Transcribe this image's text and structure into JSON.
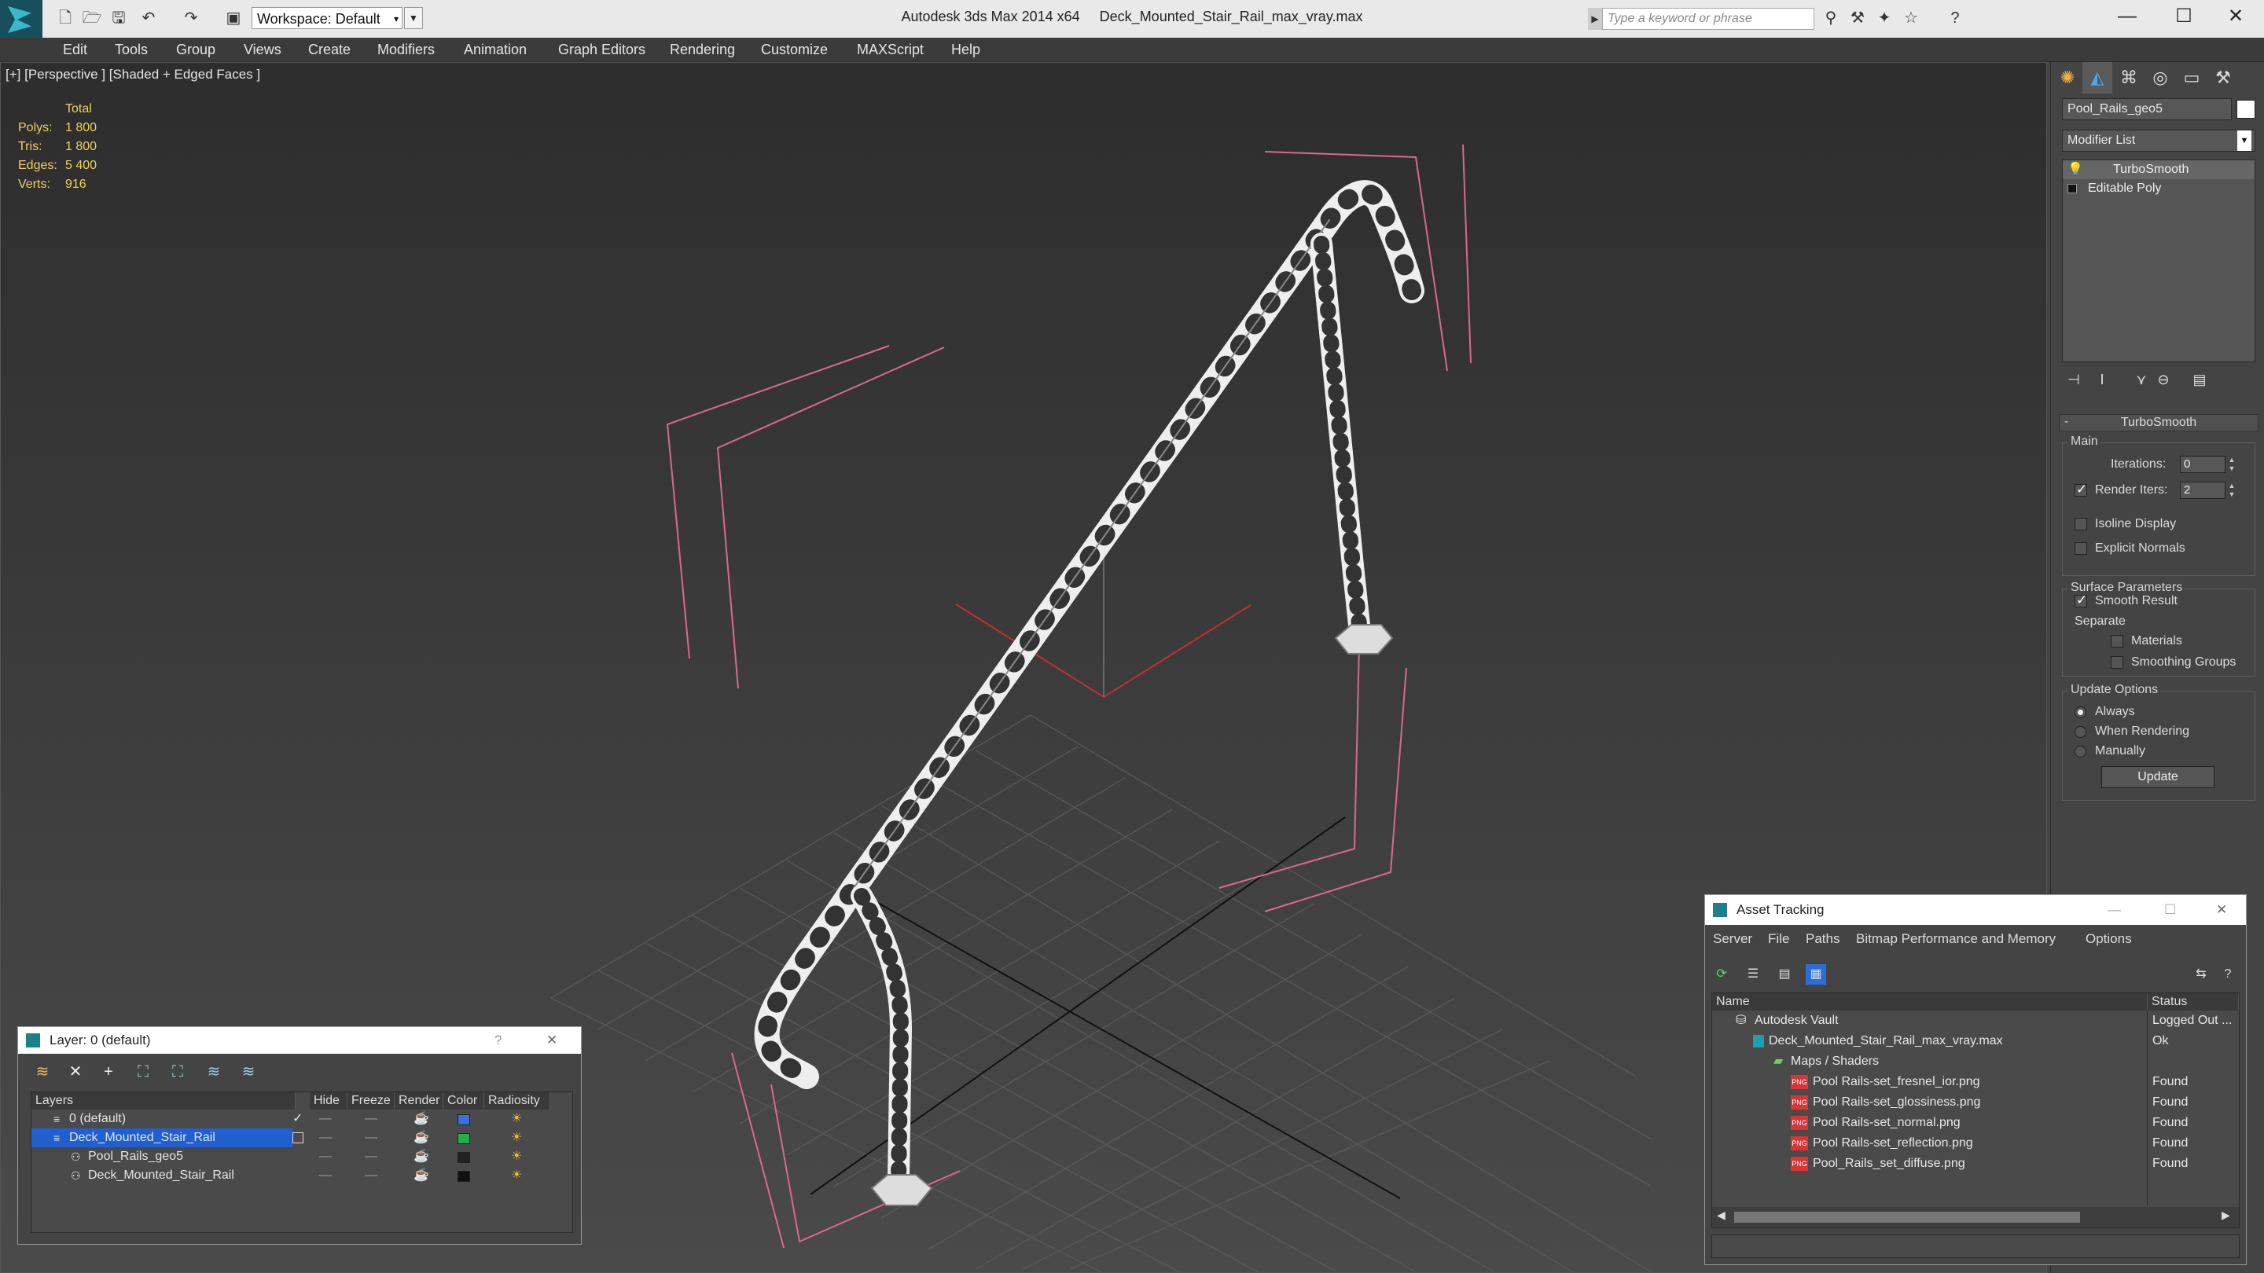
{
  "window": {
    "app_title": "Autodesk 3ds Max  2014 x64",
    "file_title": "Deck_Mounted_Stair_Rail_max_vray.max",
    "workspace": "Workspace: Default",
    "search_placeholder": "Type a keyword or phrase",
    "controls": {
      "minimize": "—",
      "maximize": "☐",
      "close": "✕"
    }
  },
  "menu": [
    "Edit",
    "Tools",
    "Group",
    "Views",
    "Create",
    "Modifiers",
    "Animation",
    "Graph Editors",
    "Rendering",
    "Customize",
    "MAXScript",
    "Help"
  ],
  "viewport": {
    "label": "[+] [Perspective ] [Shaded + Edged Faces ]",
    "stats": {
      "header": "Total",
      "rows": [
        {
          "label": "Polys:",
          "value": "1 800"
        },
        {
          "label": "Tris:",
          "value": "1 800"
        },
        {
          "label": "Edges:",
          "value": "5 400"
        },
        {
          "label": "Verts:",
          "value": "916"
        }
      ]
    }
  },
  "command_panel": {
    "object_name": "Pool_Rails_geo5",
    "modifier_list": "Modifier List",
    "stack": [
      "TurboSmooth",
      "Editable Poly"
    ],
    "rollout_title": "TurboSmooth",
    "main": {
      "title": "Main",
      "iterations_label": "Iterations:",
      "iterations_value": "0",
      "render_iters_label": "Render Iters:",
      "render_iters_value": "2",
      "isoline": "Isoline Display",
      "explicit_normals": "Explicit Normals"
    },
    "surface": {
      "title": "Surface Parameters",
      "smooth_result": "Smooth Result",
      "separate": "Separate",
      "materials": "Materials",
      "smoothing_groups": "Smoothing Groups"
    },
    "update": {
      "title": "Update Options",
      "always": "Always",
      "when_rendering": "When Rendering",
      "manually": "Manually",
      "button": "Update"
    }
  },
  "layer_panel": {
    "title": "Layer: 0 (default)",
    "help": "?",
    "close": "✕",
    "columns": [
      "Layers",
      "Hide",
      "Freeze",
      "Render",
      "Color",
      "Radiosity"
    ],
    "rows": [
      {
        "name": "0 (default)",
        "color": "#3b6fe0"
      },
      {
        "name": "Deck_Mounted_Stair_Rail",
        "color": "#22b04a"
      },
      {
        "name": "Pool_Rails_geo5",
        "color": "#222222"
      },
      {
        "name": "Deck_Mounted_Stair_Rail",
        "color": "#111111"
      }
    ]
  },
  "asset_panel": {
    "title": "Asset Tracking",
    "menu": [
      "Server",
      "File",
      "Paths",
      "Bitmap Performance and Memory",
      "Options"
    ],
    "columns": [
      "Name",
      "Status"
    ],
    "rows": [
      {
        "name": "Autodesk Vault",
        "status": "Logged Out ..."
      },
      {
        "name": "Deck_Mounted_Stair_Rail_max_vray.max",
        "status": "Ok"
      },
      {
        "name": "Maps / Shaders",
        "status": ""
      },
      {
        "name": "Pool Rails-set_fresnel_ior.png",
        "status": "Found"
      },
      {
        "name": "Pool Rails-set_glossiness.png",
        "status": "Found"
      },
      {
        "name": "Pool Rails-set_normal.png",
        "status": "Found"
      },
      {
        "name": "Pool Rails-set_reflection.png",
        "status": "Found"
      },
      {
        "name": "Pool_Rails_set_diffuse.png",
        "status": "Found"
      }
    ],
    "png_badge": "PNG"
  }
}
